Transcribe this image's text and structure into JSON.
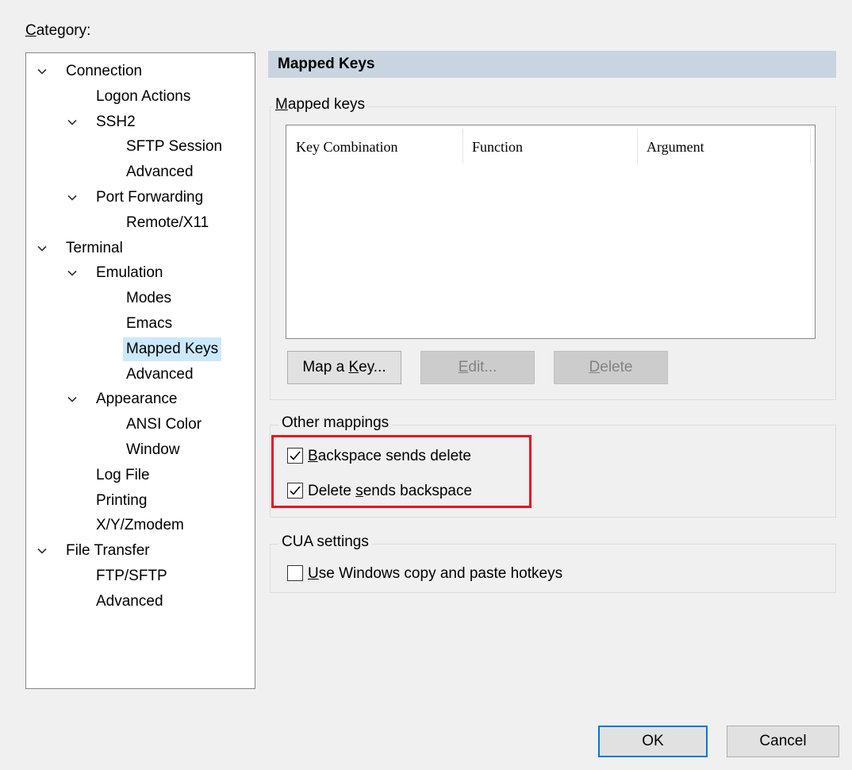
{
  "category_label": "Category:",
  "tree": [
    {
      "label": "Connection",
      "level": 0,
      "expanded": true
    },
    {
      "label": "Logon Actions",
      "level": 1
    },
    {
      "label": "SSH2",
      "level": 1,
      "expanded": true
    },
    {
      "label": "SFTP Session",
      "level": 2
    },
    {
      "label": "Advanced",
      "level": 2
    },
    {
      "label": "Port Forwarding",
      "level": 1,
      "expanded": true
    },
    {
      "label": "Remote/X11",
      "level": 2
    },
    {
      "label": "Terminal",
      "level": 0,
      "expanded": true
    },
    {
      "label": "Emulation",
      "level": 1,
      "expanded": true
    },
    {
      "label": "Modes",
      "level": 2
    },
    {
      "label": "Emacs",
      "level": 2
    },
    {
      "label": "Mapped Keys",
      "level": 2,
      "selected": true
    },
    {
      "label": "Advanced",
      "level": 2
    },
    {
      "label": "Appearance",
      "level": 1,
      "expanded": true
    },
    {
      "label": "ANSI Color",
      "level": 2
    },
    {
      "label": "Window",
      "level": 2
    },
    {
      "label": "Log File",
      "level": 1
    },
    {
      "label": "Printing",
      "level": 1
    },
    {
      "label": "X/Y/Zmodem",
      "level": 1
    },
    {
      "label": "File Transfer",
      "level": 0,
      "expanded": true
    },
    {
      "label": "FTP/SFTP",
      "level": 1
    },
    {
      "label": "Advanced",
      "level": 1
    }
  ],
  "panel": {
    "title": "Mapped Keys",
    "mapped_keys_group": {
      "title_prefix": "",
      "title_accel": "M",
      "title_rest": "apped keys",
      "columns": [
        "Key Combination",
        "Function",
        "Argument"
      ],
      "rows": []
    },
    "buttons": {
      "map_key": {
        "pre": "Map a ",
        "acc": "K",
        "post": "ey..."
      },
      "edit": {
        "pre": "",
        "acc": "E",
        "post": "dit..."
      },
      "delete": {
        "pre": "",
        "acc": "D",
        "post": "elete"
      }
    },
    "other_mappings": {
      "title": "Other mappings",
      "backspace_sends_delete": {
        "pre": "",
        "acc": "B",
        "post": "ackspace sends delete",
        "checked": true
      },
      "delete_sends_backspace": {
        "pre": "Delete ",
        "acc": "s",
        "post": "ends backspace",
        "checked": true
      }
    },
    "cua": {
      "title": "CUA settings",
      "use_windows_hotkeys": {
        "pre": "",
        "acc": "U",
        "post": "se Windows copy and paste hotkeys",
        "checked": false
      }
    }
  },
  "footer": {
    "ok": "OK",
    "cancel": "Cancel"
  },
  "colors": {
    "selection": "#cce8ff",
    "header": "#c8d4df",
    "highlight": "#e81123",
    "default_button_border": "#0078d7"
  }
}
